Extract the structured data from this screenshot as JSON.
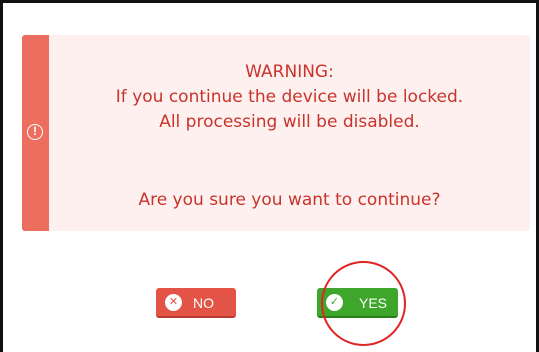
{
  "dialog": {
    "icon": "exclamation-circle-icon",
    "warning_title": "WARNING:",
    "line_continue_locked": "If you continue the device will be locked.",
    "line_processing_disabled": "All processing will be disabled.",
    "confirm_question": "Are you sure you want to continue?"
  },
  "buttons": {
    "no": {
      "label": "NO",
      "icon": "x-circle-icon",
      "icon_glyph": "✕"
    },
    "yes": {
      "label": "YES",
      "icon": "check-circle-icon",
      "icon_glyph": "✓"
    }
  },
  "annotation": {
    "highlight": "red-circle-around-yes"
  },
  "colors": {
    "warning_accent": "#ec6e5f",
    "warning_text": "#c8342c",
    "panel_background": "#fdf0ef",
    "no_button": "#e35447",
    "yes_button": "#3ea62b",
    "highlight": "#e02424"
  }
}
